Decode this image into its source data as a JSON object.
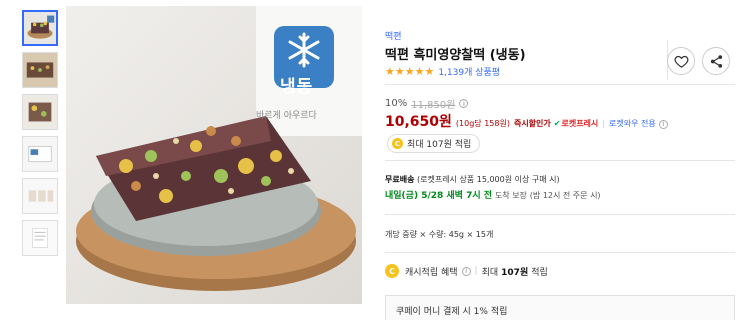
{
  "thumbnails": [
    {
      "name": "thumb-1",
      "active": true
    },
    {
      "name": "thumb-2",
      "active": false
    },
    {
      "name": "thumb-3",
      "active": false
    },
    {
      "name": "thumb-4",
      "active": false
    },
    {
      "name": "thumb-5",
      "active": false
    },
    {
      "name": "thumb-6",
      "active": false
    }
  ],
  "image": {
    "label_badge": "냉동",
    "box_text": "바르게 아우르다"
  },
  "product": {
    "brand": "떡편",
    "title": "떡편 흑미영양찰떡 (냉동)",
    "stars": "★★★★★",
    "review_count": "1,139개 상품평"
  },
  "price": {
    "discount_rate": "10%",
    "original_price": "11,850원",
    "sale_price": "10,650원",
    "unit_price": "(10g당 158원)",
    "instant_discount": "즉시할인가",
    "rocket_badge": "로켓프레시",
    "overseas_label": "로켓와우 전용",
    "reward_chip": "최대 107원 적립"
  },
  "shipping": {
    "free_label": "무료배송",
    "free_condition": "(로켓프레시 상품 15,000원 이상 구매 시)",
    "arrival_date": "내일(금) 5/28 새벽 7시 전",
    "arrival_suffix": "도착 보장",
    "arrival_note": "(밤 12시 전 주문 시)"
  },
  "option": {
    "text": "개당 중량 × 수량: 45g × 15개"
  },
  "cash": {
    "label": "캐시적립 혜택",
    "separator": "|",
    "value_prefix": "최대",
    "value": "107원",
    "value_suffix": "적립"
  },
  "coupay": {
    "text": "쿠페이 머니 결제 시 1% 적립"
  },
  "icons": {
    "heart": "heart-icon",
    "share": "share-icon",
    "info": "info-icon",
    "coin": "coin-icon",
    "snowflake": "snowflake-icon"
  },
  "colors": {
    "accent_blue": "#346aff",
    "sale_red": "#ae0000",
    "rocket_red": "#e52528",
    "delivery_green": "#00891a",
    "star_orange": "#f5a623",
    "coin_yellow": "#f7c31b"
  }
}
